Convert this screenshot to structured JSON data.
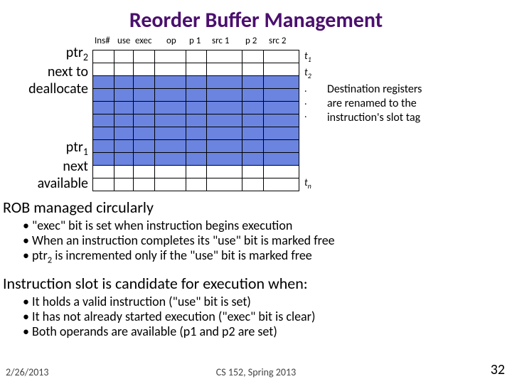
{
  "title": "Reorder Buffer Management",
  "columns": [
    "Ins#",
    "use",
    "exec",
    "op",
    "p 1",
    "src 1",
    "p 2",
    "src 2"
  ],
  "left": {
    "ptr2": "ptr",
    "ptr2_sub": "2",
    "ptr2_line2": "next to",
    "ptr2_line3": "deallocate",
    "ptr1": "ptr",
    "ptr1_sub": "1",
    "ptr1_line2": "next",
    "ptr1_line3": "available"
  },
  "right": {
    "t1": "t",
    "t1s": "1",
    "t2": "t",
    "t2s": "2",
    "dots": ". . .",
    "tn": "t",
    "tns": "n"
  },
  "dest_note_l1": "Destination registers",
  "dest_note_l2": " are renamed to the",
  "dest_note_l3": "instruction's slot tag",
  "section1": "ROB managed circularly",
  "bullets1": [
    "\"exec\" bit is set when instruction begins execution",
    "When an instruction completes its \"use\" bit is marked free",
    "ptr2 is incremented only if the \"use\" bit is marked free"
  ],
  "section2": "Instruction slot is candidate for execution when:",
  "bullets2": [
    "It holds a valid instruction (\"use\" bit is set)",
    "It has not already started execution (\"exec\" bit is clear)",
    "Both operands are available (p1 and p2 are set)"
  ],
  "footer": {
    "date": "2/26/2013",
    "course": "CS 152, Spring 2013",
    "page": "32"
  },
  "chart_data": {
    "type": "table",
    "description": "Reorder Buffer (ROB) schematic: 11 rows, each row has fields Ins#, use, exec, op, p1, src1, p2, src2. Rows are shown shaded (occupied/blue) or empty (white). ptr2 points near top (next to deallocate), ptr1 points lower (next available).",
    "columns": [
      "Ins#",
      "use",
      "exec",
      "op",
      "p1",
      "src1",
      "p2",
      "src2"
    ],
    "row_states": [
      "white",
      "white",
      "blue",
      "blue",
      "blue",
      "blue",
      "blue",
      "blue",
      "blue",
      "white",
      "white"
    ]
  }
}
